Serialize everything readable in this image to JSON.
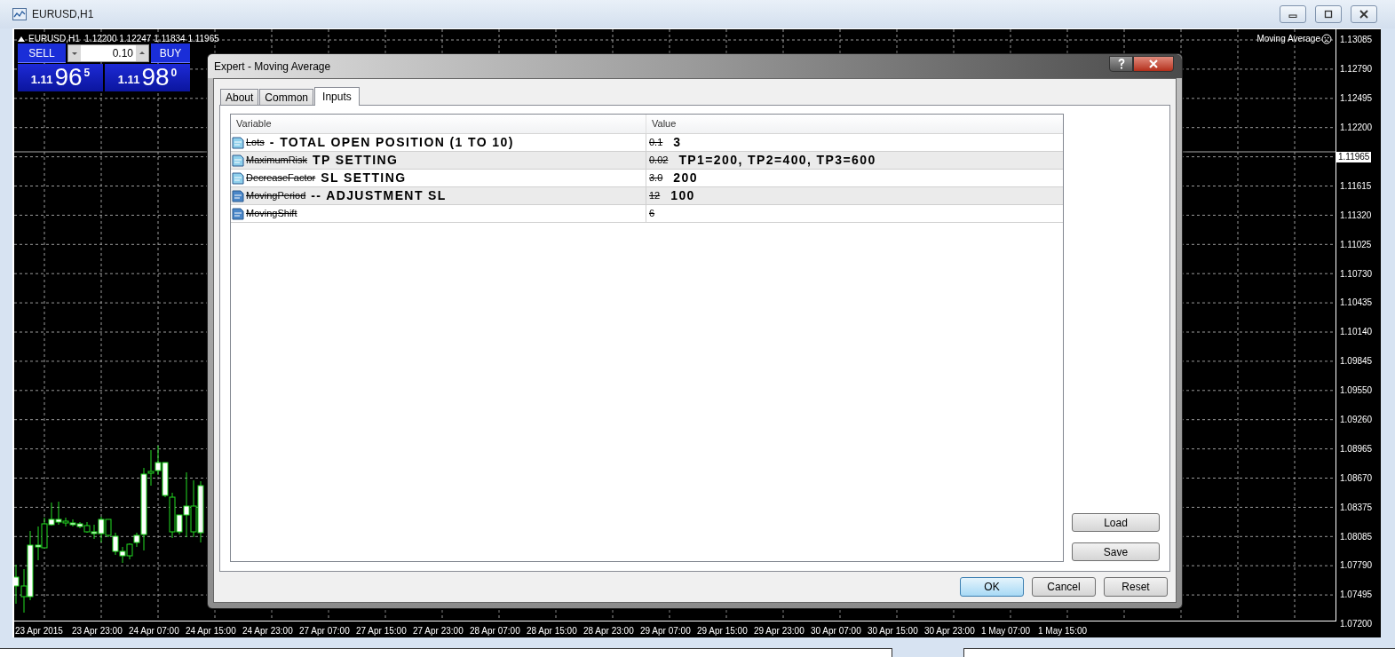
{
  "window": {
    "title": "EURUSD,H1"
  },
  "chart": {
    "header": "EURUSD,H1  1.12200 1.12247 1.11834 1.11965",
    "indicator": "Moving Average",
    "price_axis": [
      {
        "text": "1.13085",
        "kind": "tick"
      },
      {
        "text": "1.12790",
        "kind": "tick"
      },
      {
        "text": "1.12495",
        "kind": "tick"
      },
      {
        "text": "1.12200",
        "kind": "tick"
      },
      {
        "text": "1.11965",
        "kind": "current"
      },
      {
        "text": "1.11615",
        "kind": "tick"
      },
      {
        "text": "1.11320",
        "kind": "tick"
      },
      {
        "text": "1.11025",
        "kind": "tick"
      },
      {
        "text": "1.10730",
        "kind": "tick"
      },
      {
        "text": "1.10435",
        "kind": "tick"
      },
      {
        "text": "1.10140",
        "kind": "tick"
      },
      {
        "text": "1.09845",
        "kind": "tick"
      },
      {
        "text": "1.09550",
        "kind": "tick"
      },
      {
        "text": "1.09260",
        "kind": "tick"
      },
      {
        "text": "1.08965",
        "kind": "tick"
      },
      {
        "text": "1.08670",
        "kind": "tick"
      },
      {
        "text": "1.08375",
        "kind": "tick"
      },
      {
        "text": "1.08085",
        "kind": "tick"
      },
      {
        "text": "1.07790",
        "kind": "tick"
      },
      {
        "text": "1.07495",
        "kind": "tick"
      },
      {
        "text": "1.07200",
        "kind": "tick"
      }
    ],
    "time_axis": [
      "23 Apr 2015",
      "23 Apr 23:00",
      "24 Apr 07:00",
      "24 Apr 15:00",
      "24 Apr 23:00",
      "27 Apr 07:00",
      "27 Apr 15:00",
      "27 Apr 23:00",
      "28 Apr 07:00",
      "28 Apr 15:00",
      "28 Apr 23:00",
      "29 Apr 07:00",
      "29 Apr 15:00",
      "29 Apr 23:00",
      "30 Apr 07:00",
      "30 Apr 15:00",
      "30 Apr 23:00",
      "1 May 07:00",
      "1 May 15:00"
    ]
  },
  "trade_panel": {
    "sell": "SELL",
    "buy": "BUY",
    "lot": "0.10",
    "bid": {
      "prefix": "1.11",
      "main": "96",
      "small": "5"
    },
    "ask": {
      "prefix": "1.11",
      "main": "98",
      "small": "0"
    }
  },
  "dialog": {
    "title": "Expert - Moving Average",
    "tabs": [
      {
        "label": "About",
        "selected": false
      },
      {
        "label": "Common",
        "selected": false
      },
      {
        "label": "Inputs",
        "selected": true
      }
    ],
    "columns": [
      "Variable",
      "Value"
    ],
    "rows": [
      {
        "kind": "double",
        "name": "Lots",
        "note": "- TOTAL OPEN POSITION (1 TO 10)",
        "value": "0.1",
        "value_note": "3"
      },
      {
        "kind": "double",
        "name": "MaximumRisk",
        "note": "TP SETTING",
        "value": "0.02",
        "value_note": "TP1=200, TP2=400, TP3=600"
      },
      {
        "kind": "double",
        "name": "DecreaseFactor",
        "note": "SL SETTING",
        "value": "3.0",
        "value_note": "200"
      },
      {
        "kind": "integer",
        "name": "MovingPeriod",
        "note": "-- ADJUSTMENT SL",
        "value": "12",
        "value_note": "100"
      },
      {
        "kind": "integer",
        "name": "MovingShift",
        "value": "6"
      }
    ],
    "side_buttons": [
      "Load",
      "Save"
    ],
    "buttons": [
      {
        "label": "OK",
        "default": true
      },
      {
        "label": "Cancel",
        "default": false
      },
      {
        "label": "Reset",
        "default": false
      }
    ]
  }
}
